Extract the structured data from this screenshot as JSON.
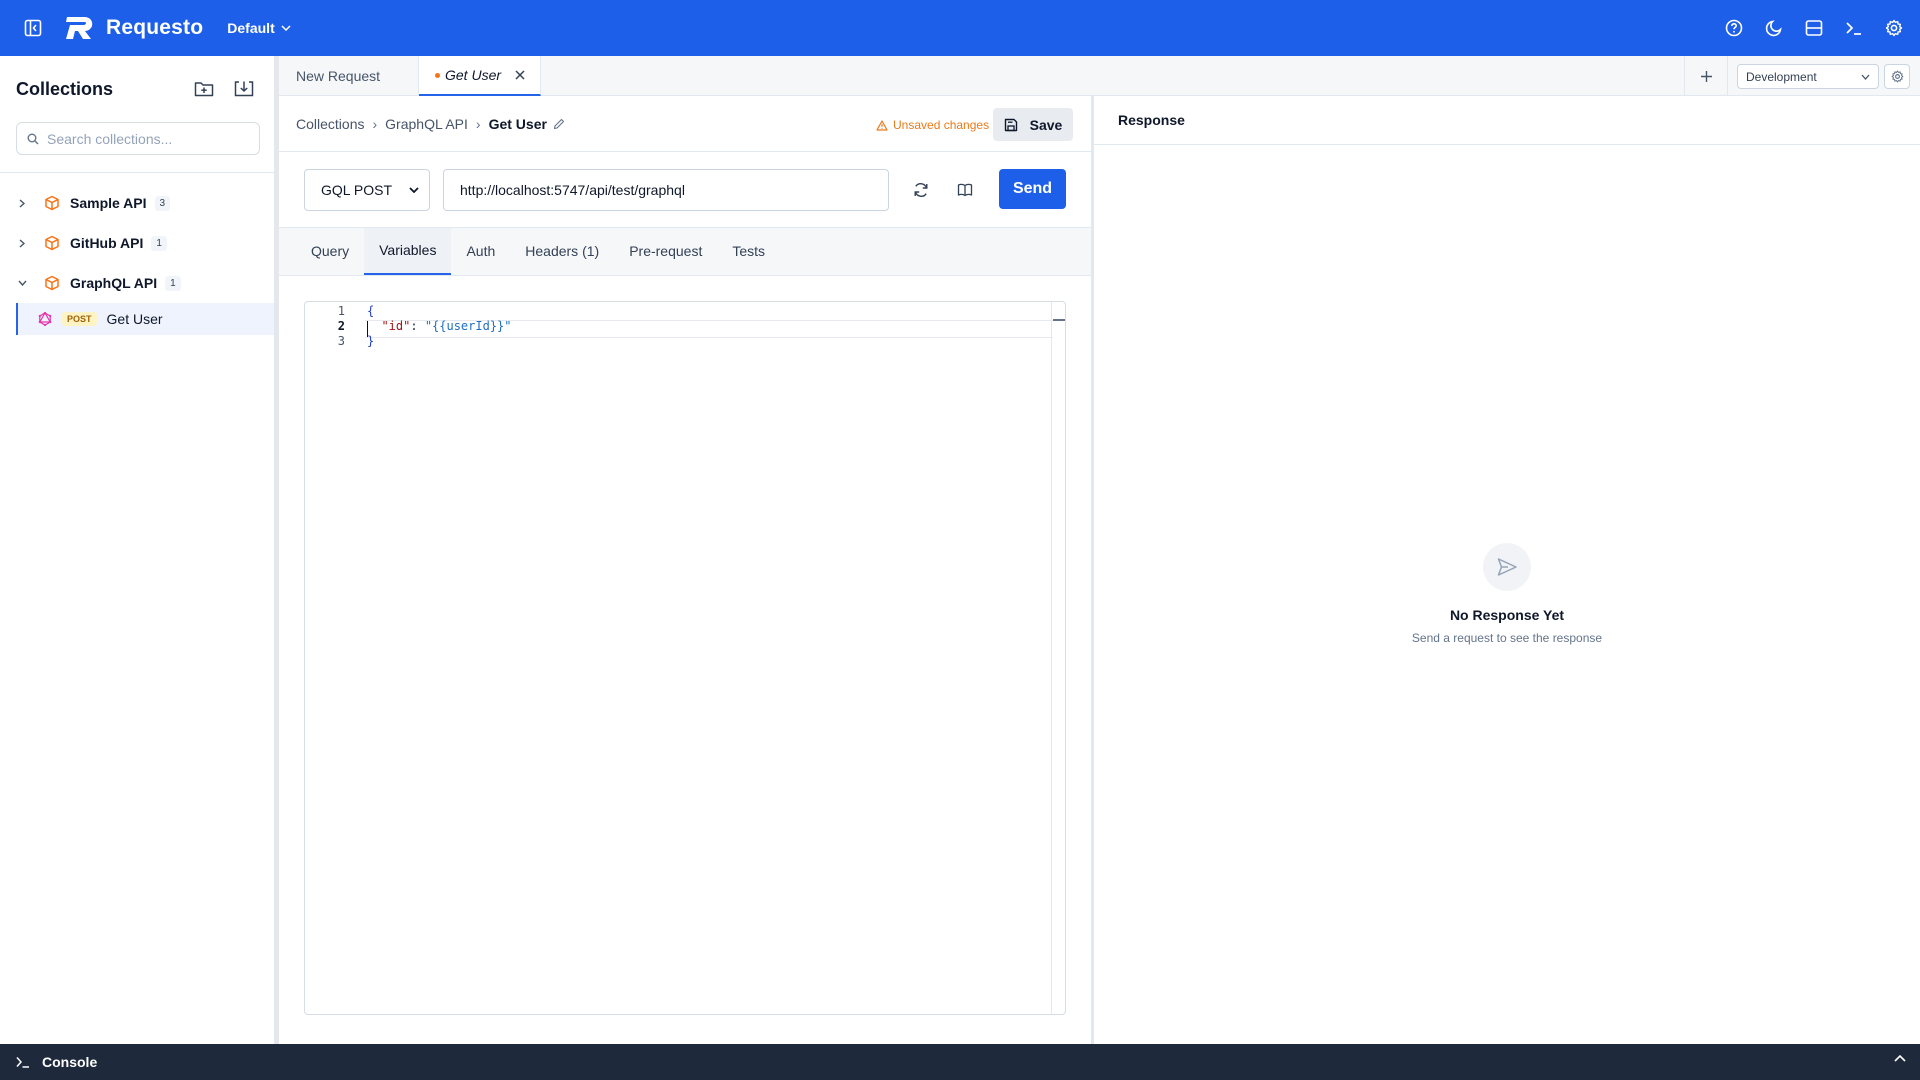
{
  "app": {
    "name": "Requesto",
    "workspace": "Default"
  },
  "sidebar": {
    "title": "Collections",
    "search_placeholder": "Search collections...",
    "collections": [
      {
        "name": "Sample API",
        "count": "3",
        "expanded": false
      },
      {
        "name": "GitHub API",
        "count": "1",
        "expanded": false
      },
      {
        "name": "GraphQL API",
        "count": "1",
        "expanded": true
      }
    ],
    "request": {
      "method": "POST",
      "name": "Get User"
    }
  },
  "tabs": {
    "items": [
      {
        "label": "New Request"
      },
      {
        "label": "Get User",
        "active": true,
        "unsaved": true
      }
    ],
    "environment": "Development"
  },
  "request": {
    "breadcrumb": [
      "Collections",
      "GraphQL API"
    ],
    "separator": "›",
    "current": "Get User",
    "unsaved_label": "Unsaved changes",
    "save_label": "Save",
    "method": "GQL POST",
    "url": "http://localhost:5747/api/test/graphql",
    "send_label": "Send",
    "subtabs": [
      "Query",
      "Variables",
      "Auth",
      "Headers (1)",
      "Pre-request",
      "Tests"
    ],
    "active_subtab": "Variables",
    "editor": {
      "line_numbers": [
        "1",
        "2",
        "3"
      ],
      "open_brace": "{",
      "key": "\"id\"",
      "colon": ": ",
      "value": "\"{{userId}}\"",
      "close_brace": "}"
    }
  },
  "response": {
    "title": "Response",
    "empty_title": "No Response Yet",
    "empty_subtitle": "Send a request to see the response"
  },
  "console": {
    "label": "Console"
  },
  "colors": {
    "primary": "#1d5fe8",
    "warning": "#ea7a1a",
    "console_bg": "#1e293b",
    "collection_icon": "#f97316",
    "graphql_icon": "#e535ab"
  }
}
